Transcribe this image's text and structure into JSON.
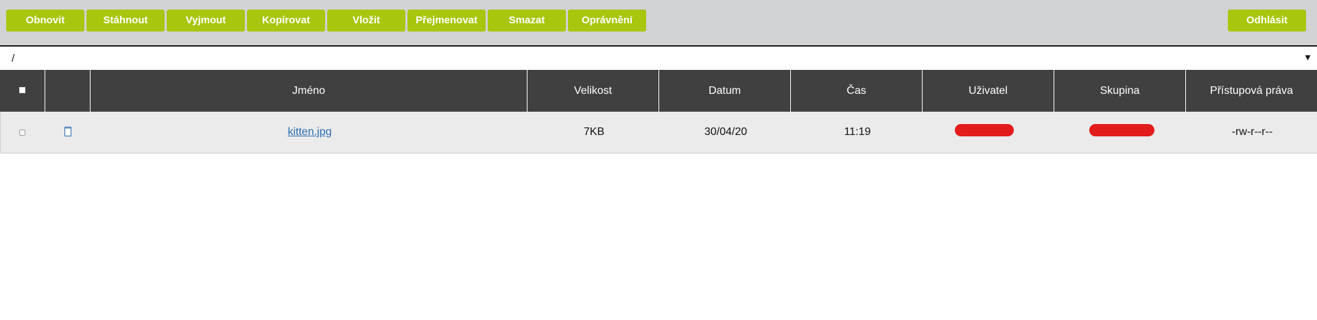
{
  "toolbar": {
    "buttons": [
      {
        "label": "Obnovit"
      },
      {
        "label": "Stáhnout"
      },
      {
        "label": "Vyjmout"
      },
      {
        "label": "Kopírovat"
      },
      {
        "label": "Vložit"
      },
      {
        "label": "Přejmenovat"
      },
      {
        "label": "Smazat"
      },
      {
        "label": "Oprávnění"
      }
    ],
    "logout_label": "Odhlásit",
    "button_color": "#a8c60d"
  },
  "path": {
    "value": "/",
    "dropdown_icon": "triangle-down-icon"
  },
  "table": {
    "columns": [
      "Jméno",
      "Velikost",
      "Datum",
      "Čas",
      "Uživatel",
      "Skupina",
      "Přístupová práva"
    ],
    "rows": [
      {
        "name": "kitten.jpg",
        "size": "7KB",
        "date": "30/04/20",
        "time": "11:19",
        "permissions": "-rw-r--r--",
        "icon": "file-icon"
      }
    ],
    "header_color": "#404040",
    "redaction_color": "#e31b1b"
  }
}
